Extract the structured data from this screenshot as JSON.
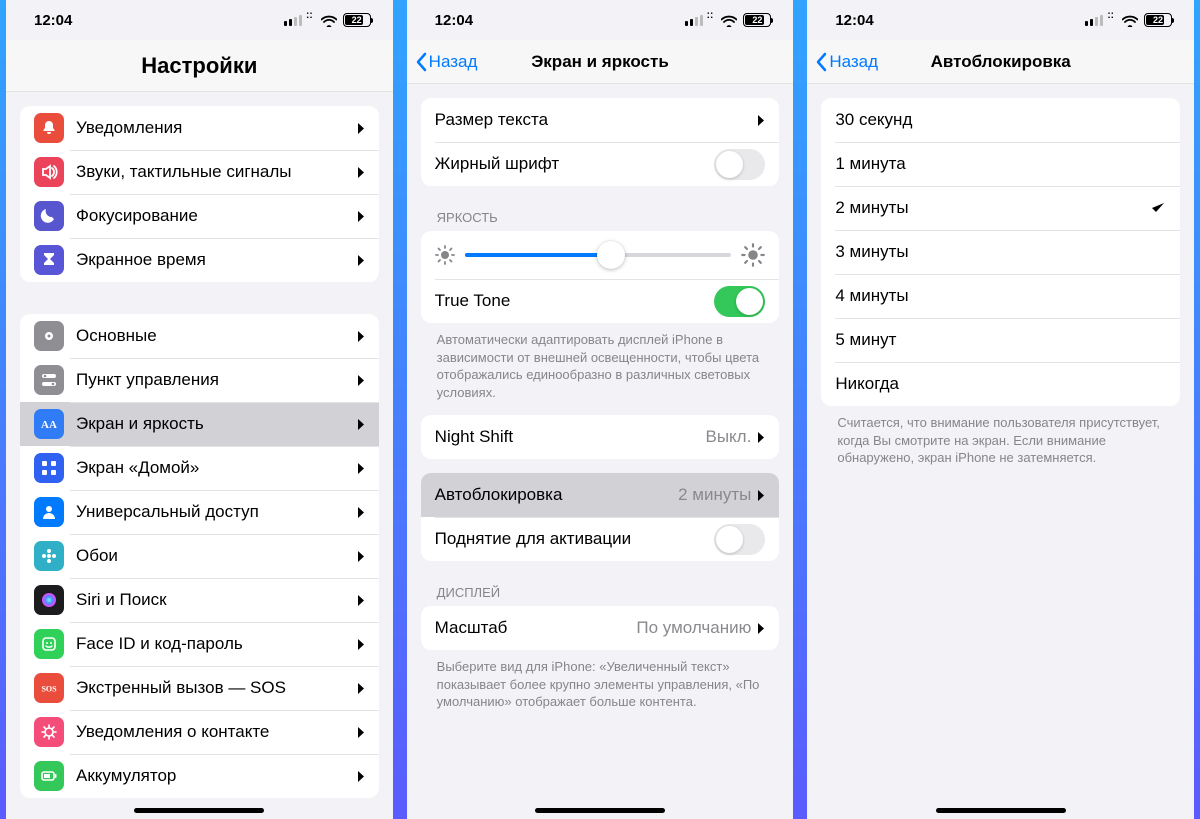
{
  "status": {
    "time": "12:04",
    "battery": "22"
  },
  "screen1": {
    "title": "Настройки",
    "group1": [
      {
        "icon": "bell",
        "color": "ic-red",
        "label": "Уведомления"
      },
      {
        "icon": "speaker",
        "color": "ic-pink",
        "label": "Звуки, тактильные сигналы"
      },
      {
        "icon": "moon",
        "color": "ic-purple",
        "label": "Фокусирование"
      },
      {
        "icon": "hourglass",
        "color": "ic-indigo",
        "label": "Экранное время"
      }
    ],
    "group2": [
      {
        "icon": "gear",
        "color": "ic-gray",
        "label": "Основные"
      },
      {
        "icon": "switches",
        "color": "ic-gray2",
        "label": "Пункт управления"
      },
      {
        "icon": "aa",
        "color": "ic-blue",
        "label": "Экран и яркость",
        "selected": true
      },
      {
        "icon": "grid",
        "color": "ic-bluegrid",
        "label": "Экран «Домой»"
      },
      {
        "icon": "person",
        "color": "ic-acc",
        "label": "Универсальный доступ"
      },
      {
        "icon": "flower",
        "color": "ic-teal",
        "label": "Обои"
      },
      {
        "icon": "siri",
        "color": "ic-black",
        "label": "Siri и Поиск"
      },
      {
        "icon": "face",
        "color": "ic-green",
        "label": "Face ID и код-пароль"
      },
      {
        "icon": "sos",
        "color": "ic-redso",
        "label": "Экстренный вызов — SOS"
      },
      {
        "icon": "virus",
        "color": "ic-pinksp",
        "label": "Уведомления о контакте"
      },
      {
        "icon": "battery",
        "color": "ic-greenb",
        "label": "Аккумулятор"
      }
    ]
  },
  "screen2": {
    "back": "Назад",
    "title": "Экран и яркость",
    "text_size": "Размер текста",
    "bold": "Жирный шрифт",
    "brightness_header": "ЯРКОСТЬ",
    "truetone": "True Tone",
    "truetone_footer": "Автоматически адаптировать дисплей iPhone в зависимости от внешней освещенности, чтобы цвета отображались единообразно в различных световых условиях.",
    "nightshift": "Night Shift",
    "nightshift_value": "Выкл.",
    "autolock": "Автоблокировка",
    "autolock_value": "2 минуты",
    "raise": "Поднятие для активации",
    "display_header": "ДИСПЛЕЙ",
    "zoom": "Масштаб",
    "zoom_value": "По умолчанию",
    "zoom_footer": "Выберите вид для iPhone: «Увеличенный текст» показывает более крупно элементы управления, «По умолчанию» отображает больше контента."
  },
  "screen3": {
    "back": "Назад",
    "title": "Автоблокировка",
    "options": [
      {
        "label": "30 секунд"
      },
      {
        "label": "1 минута"
      },
      {
        "label": "2 минуты",
        "checked": true
      },
      {
        "label": "3 минуты"
      },
      {
        "label": "4 минуты"
      },
      {
        "label": "5 минут"
      },
      {
        "label": "Никогда"
      }
    ],
    "footer": "Считается, что внимание пользователя присутствует, когда Вы смотрите на экран. Если внимание обнаружено, экран iPhone не затемняется."
  }
}
